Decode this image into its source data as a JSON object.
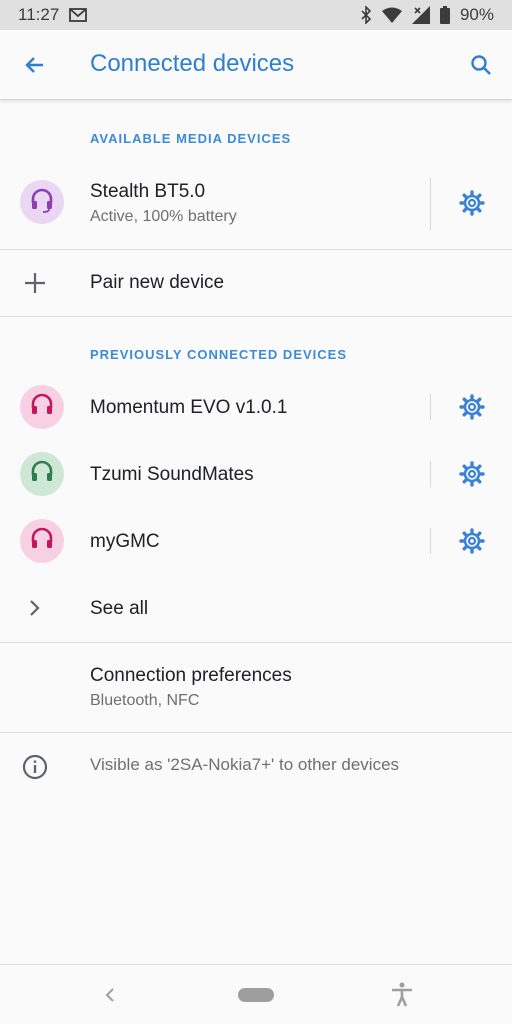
{
  "status_bar": {
    "time": "11:27",
    "battery": "90%",
    "icons": [
      "email-icon",
      "bluetooth-icon",
      "wifi-icon",
      "signal-icon",
      "battery-icon"
    ]
  },
  "app_bar": {
    "title": "Connected devices",
    "icons": [
      "back-arrow-icon",
      "search-icon"
    ]
  },
  "available": {
    "header": "AVAILABLE MEDIA DEVICES",
    "devices": [
      {
        "name": "Stealth BT5.0",
        "status": "Active, 100% battery",
        "icon": "headset-icon",
        "avatar_bg": "#ead7f3",
        "icon_color": "#8b3fb0"
      }
    ]
  },
  "pair_new": {
    "label": "Pair new device",
    "icon": "plus-icon"
  },
  "previous": {
    "header": "PREVIOUSLY CONNECTED DEVICES",
    "devices": [
      {
        "name": "Momentum EVO v1.0.1",
        "icon": "headset-icon",
        "avatar_bg": "#f8d0e3",
        "icon_color": "#c2185b"
      },
      {
        "name": "Tzumi SoundMates",
        "icon": "headset-icon",
        "avatar_bg": "#cfe8d6",
        "icon_color": "#2e7d4f"
      },
      {
        "name": "myGMC",
        "icon": "headset-icon",
        "avatar_bg": "#f8d0e3",
        "icon_color": "#c2185b"
      }
    ]
  },
  "see_all": {
    "label": "See all",
    "icon": "chevron-right-icon"
  },
  "connection_prefs": {
    "title": "Connection preferences",
    "subtitle": "Bluetooth, NFC"
  },
  "footer": {
    "text": "Visible as '2SA-Nokia7+' to other devices",
    "icon": "info-icon"
  },
  "nav_bar": {
    "icons": [
      "nav-back-icon",
      "home-pill",
      "accessibility-icon"
    ]
  },
  "colors": {
    "accent": "#2f7fd1",
    "gear": "#3b82d6",
    "text_secondary": "#6f6f6f"
  }
}
